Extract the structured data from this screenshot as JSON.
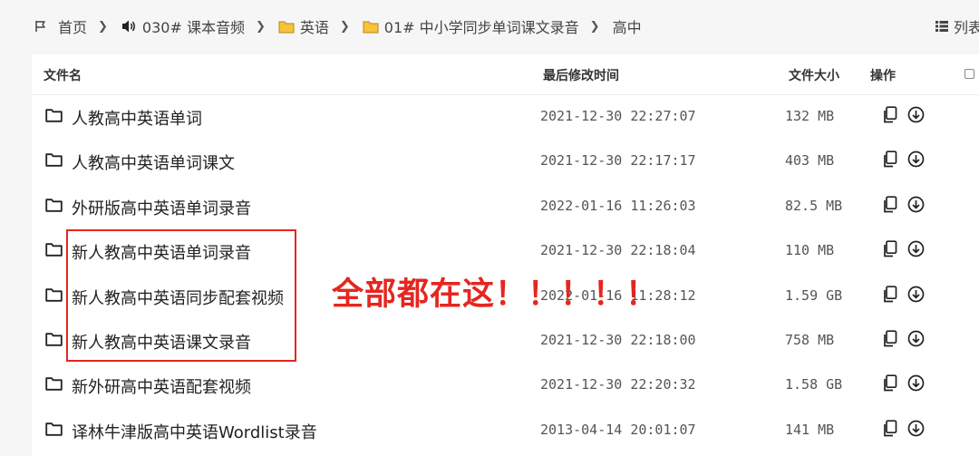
{
  "breadcrumb": {
    "home": "首页",
    "items": [
      {
        "label": "030# 课本音频",
        "icon": "speaker-icon"
      },
      {
        "label": "英语",
        "icon": "folder-icon"
      },
      {
        "label": "01# 中小学同步单词课文录音",
        "icon": "folder-icon"
      },
      {
        "label": "高中",
        "icon": ""
      }
    ],
    "home_icon": "flag-icon"
  },
  "view_toggle": {
    "label": "列表",
    "icon": "list-icon"
  },
  "table": {
    "headers": {
      "name": "文件名",
      "modified": "最后修改时间",
      "size": "文件大小",
      "actions": "操作"
    },
    "rows": [
      {
        "name": "人教高中英语单词",
        "modified": "2021-12-30 22:27:07",
        "size": "132 MB"
      },
      {
        "name": "人教高中英语单词课文",
        "modified": "2021-12-30 22:17:17",
        "size": "403 MB"
      },
      {
        "name": "外研版高中英语单词录音",
        "modified": "2022-01-16 11:26:03",
        "size": "82.5 MB"
      },
      {
        "name": "新人教高中英语单词录音",
        "modified": "2021-12-30 22:18:04",
        "size": "110 MB"
      },
      {
        "name": "新人教高中英语同步配套视频",
        "modified": "2022-01-16 11:28:12",
        "size": "1.59 GB"
      },
      {
        "name": "新人教高中英语课文录音",
        "modified": "2021-12-30 22:18:00",
        "size": "758 MB"
      },
      {
        "name": "新外研高中英语配套视频",
        "modified": "2021-12-30 22:20:32",
        "size": "1.58 GB"
      },
      {
        "name": "译林牛津版高中英语Wordlist录音",
        "modified": "2013-04-14 20:01:07",
        "size": "141 MB"
      }
    ]
  },
  "annotation": {
    "text": "全部都在这！！！！！",
    "color": "#e52620"
  }
}
